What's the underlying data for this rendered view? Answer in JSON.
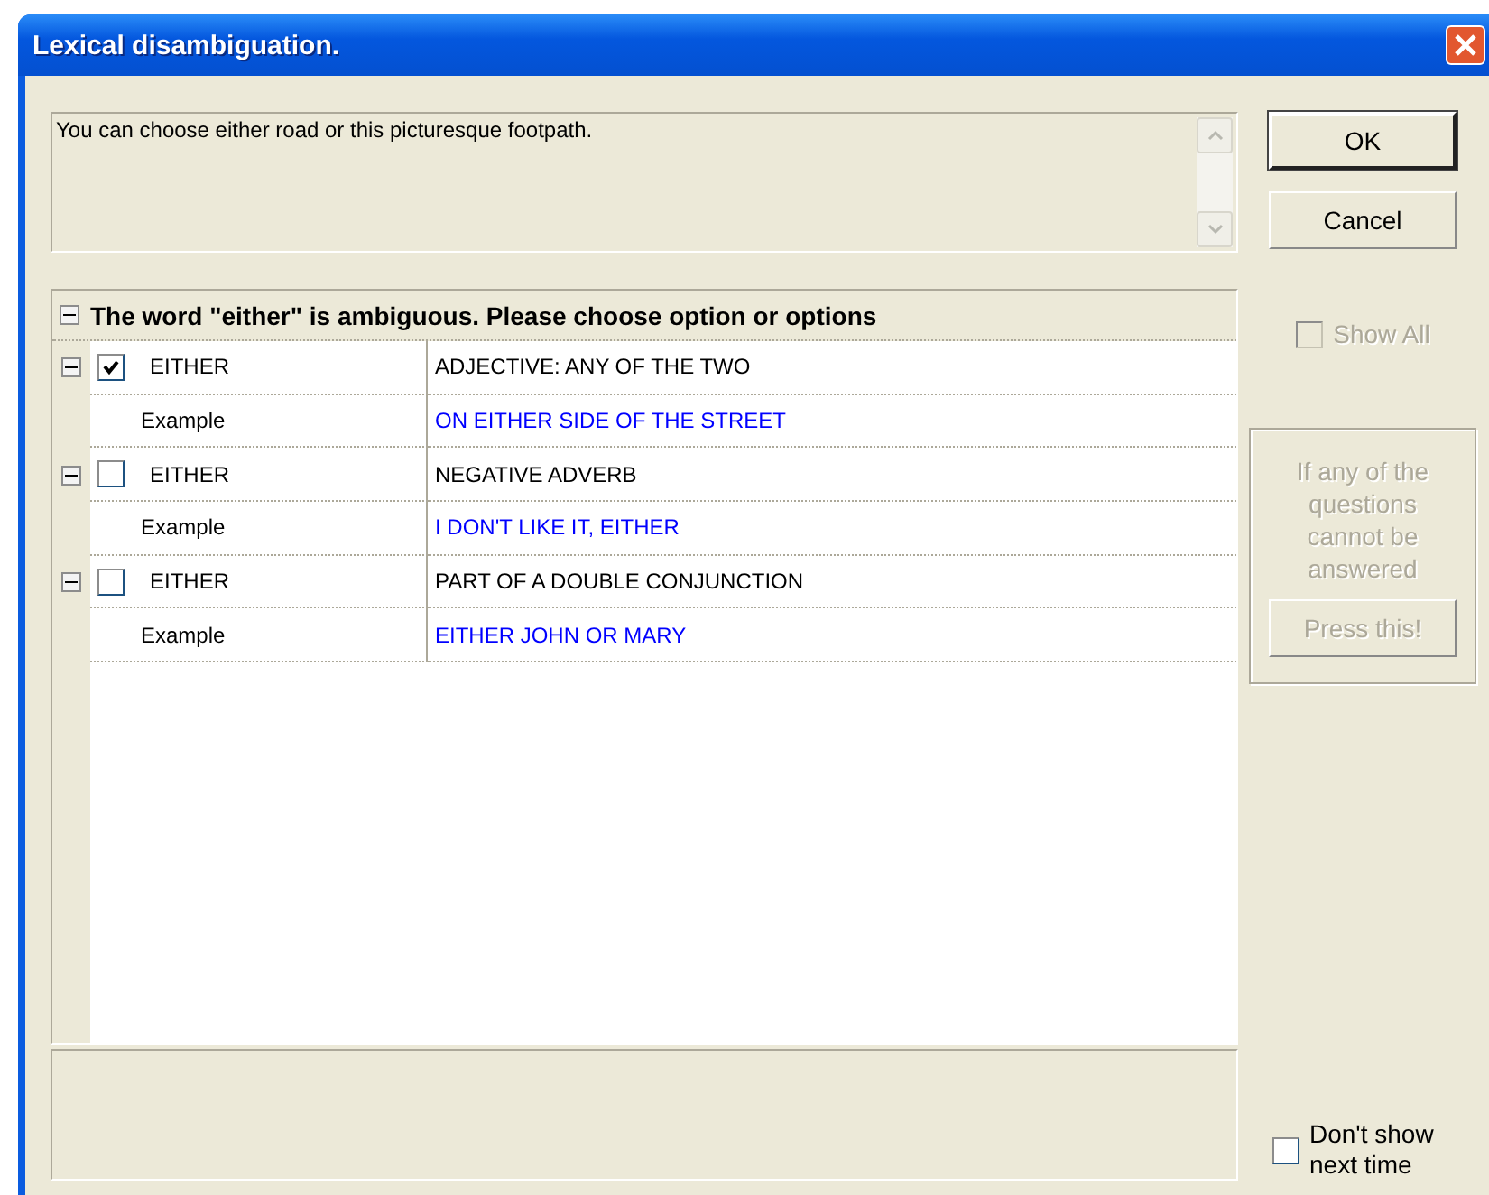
{
  "window": {
    "title": "Lexical disambiguation."
  },
  "sentence": "You can choose either road or this picturesque footpath.",
  "buttons": [
    {
      "label": "OK",
      "default": true
    },
    {
      "label": "Cancel",
      "default": false
    }
  ],
  "tree": {
    "header": "The word \"either\" is ambiguous. Please choose option or options",
    "expanded": true,
    "senses": [
      {
        "word": "EITHER",
        "checked": true,
        "expanded": true,
        "meaning": "ADJECTIVE: ANY OF THE TWO",
        "example_label": "Example",
        "example": "ON EITHER SIDE OF THE STREET"
      },
      {
        "word": "EITHER",
        "checked": false,
        "expanded": true,
        "meaning": "NEGATIVE ADVERB",
        "example_label": "Example",
        "example": "I DON'T LIKE IT, EITHER"
      },
      {
        "word": "EITHER",
        "checked": false,
        "expanded": true,
        "meaning": "PART OF A DOUBLE CONJUNCTION",
        "example_label": "Example",
        "example": "EITHER JOHN OR MARY"
      }
    ]
  },
  "show_all": {
    "label": "Show All",
    "checked": false,
    "disabled": true
  },
  "help_box": {
    "text": "If any of the questions cannot be answered",
    "button": "Press this!",
    "disabled": true
  },
  "dont_show": {
    "label": "Don't show next time",
    "checked": false
  }
}
